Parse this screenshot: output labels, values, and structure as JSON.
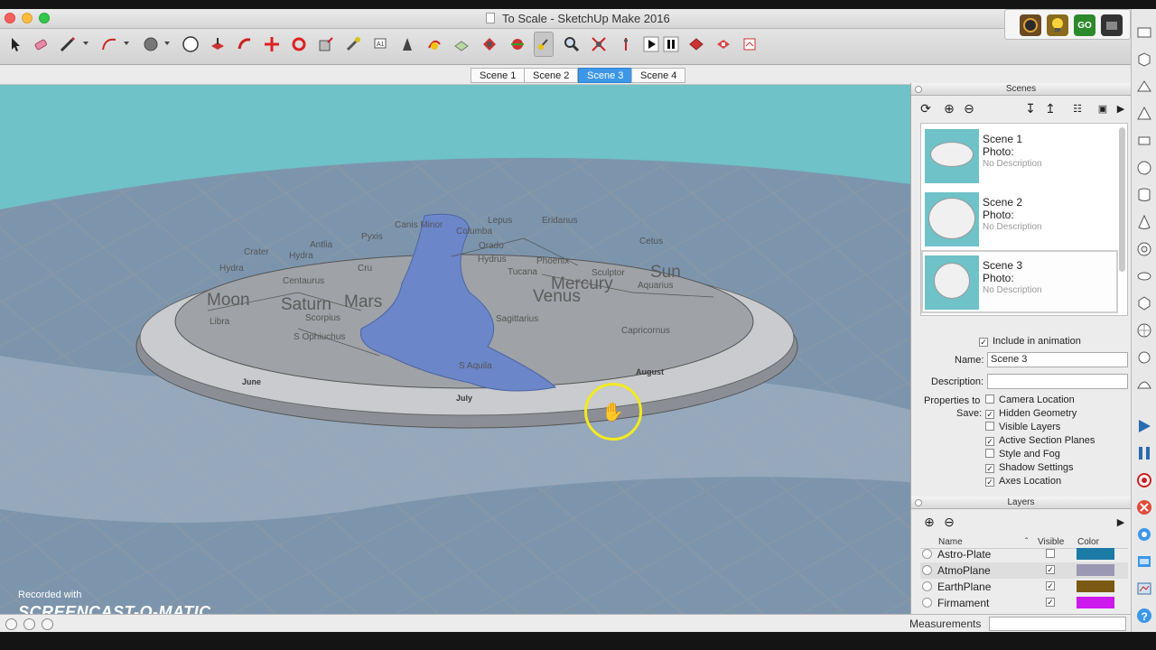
{
  "window": {
    "title": "To Scale - SketchUp Make 2016"
  },
  "toolbar": {
    "tools": [
      "select-icon",
      "eraser-icon",
      "pencil-icon",
      "arc-icon",
      "paint-bucket-icon",
      "circle-icon",
      "push-pull-icon",
      "follow-me-icon",
      "move-icon",
      "rotate-icon",
      "scale-icon",
      "tape-measure-icon",
      "text-icon",
      "axes-icon",
      "dimension-icon",
      "section-plane-icon",
      "walk-icon",
      "look-around-icon",
      "position-camera-icon",
      "zoom-icon",
      "zoom-extents-icon",
      "orbit-icon",
      "play-icon",
      "pause-icon",
      "warehouse-icon",
      "extension-warehouse-icon",
      "layout-icon"
    ]
  },
  "extensions": {
    "go_label": "GO"
  },
  "scene_tabs": [
    {
      "label": "Scene 1",
      "active": false
    },
    {
      "label": "Scene 2",
      "active": false
    },
    {
      "label": "Scene 3",
      "active": true
    },
    {
      "label": "Scene 4",
      "active": false
    }
  ],
  "viewport": {
    "big_labels": [
      "Moon",
      "Saturn",
      "Mars",
      "Venus",
      "Mercury",
      "Sun"
    ],
    "constellations": [
      "Canis Minor",
      "Lepus",
      "Eridanus",
      "Columba",
      "Pyxis",
      "Antlia",
      "Crater",
      "Hydra",
      "Hydra",
      "Orado",
      "Cetus",
      "Centaurus",
      "Hydrus",
      "Phoenix",
      "Tucana",
      "Sculptor",
      "Cru",
      "Aquarius",
      "Libra",
      "Scorpius",
      "S Ophiuchus",
      "Sagittarius",
      "Capricornus",
      "S Aquila"
    ],
    "months": [
      "July",
      "August",
      "June"
    ],
    "watermark_line1": "Recorded with",
    "watermark_line2": "SCREENCAST-O-MATIC"
  },
  "scenes_panel": {
    "title": "Scenes",
    "scenes": [
      {
        "name": "Scene 1",
        "photo": "Photo:",
        "description": "No Description",
        "selected": false
      },
      {
        "name": "Scene 2",
        "photo": "Photo:",
        "description": "No Description",
        "selected": false
      },
      {
        "name": "Scene 3",
        "photo": "Photo:",
        "description": "No Description",
        "selected": true
      }
    ],
    "include_in_animation": "Include in animation",
    "name_label": "Name:",
    "name_value": "Scene 3",
    "description_label": "Description:",
    "description_value": "",
    "properties_label_1": "Properties to",
    "properties_label_2": "Save:",
    "properties": [
      {
        "label": "Camera Location",
        "checked": false
      },
      {
        "label": "Hidden Geometry",
        "checked": true
      },
      {
        "label": "Visible Layers",
        "checked": false
      },
      {
        "label": "Active Section Planes",
        "checked": true
      },
      {
        "label": "Style and Fog",
        "checked": false
      },
      {
        "label": "Shadow Settings",
        "checked": true
      },
      {
        "label": "Axes Location",
        "checked": true
      }
    ]
  },
  "layers_panel": {
    "title": "Layers",
    "columns": {
      "name": "Name",
      "visible": "Visible",
      "color": "Color"
    },
    "layers": [
      {
        "name": "Astro-Plate",
        "visible": false,
        "color": "#1b7aa6",
        "selected": false
      },
      {
        "name": "AtmoPlane",
        "visible": true,
        "color": "#9b98b4",
        "selected": true
      },
      {
        "name": "EarthPlane",
        "visible": true,
        "color": "#7a5a12",
        "selected": false
      },
      {
        "name": "Firmament",
        "visible": true,
        "color": "#cc19ee",
        "selected": false
      }
    ]
  },
  "statusbar": {
    "measurements_label": "Measurements",
    "measurements_value": ""
  },
  "colors": {
    "sky": "#6fc2c7",
    "accent": "#3d97e8",
    "cursor_ring": "#f3ea1f",
    "water": "#6b86c9"
  }
}
